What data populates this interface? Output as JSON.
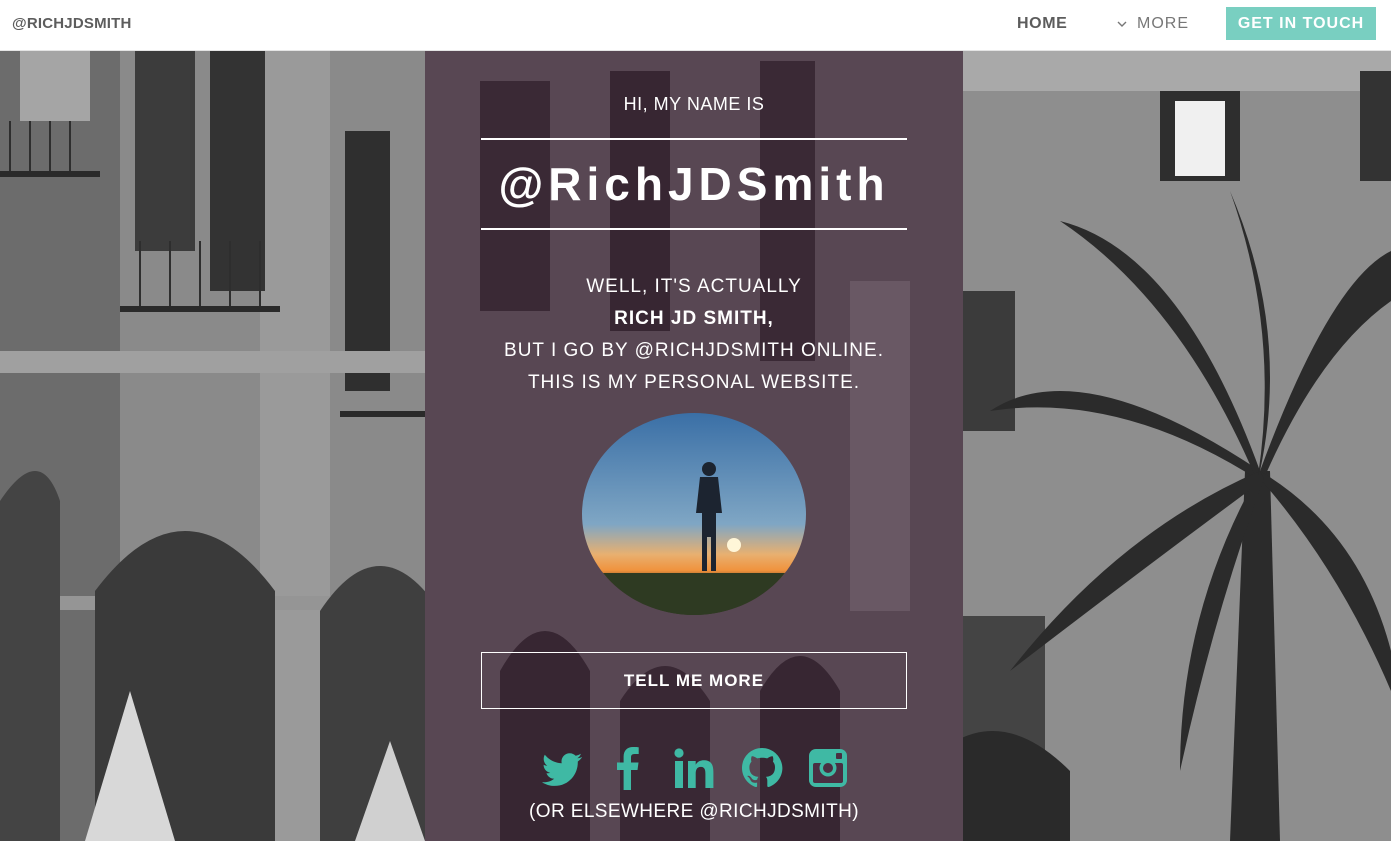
{
  "nav": {
    "brand": "@RICHJDSMITH",
    "home": "HOME",
    "more": "MORE",
    "cta": "GET IN TOUCH"
  },
  "hero": {
    "greeting": "HI, MY NAME IS",
    "handle": "@RichJDSmith",
    "intro_line1": "WELL, IT'S ACTUALLY",
    "intro_name": "RICH JD SMITH,",
    "intro_line3": "BUT I GO BY @RICHJDSMITH ONLINE.",
    "intro_line4": "THIS IS MY PERSONAL WEBSITE.",
    "button": "TELL ME MORE",
    "elsewhere": "(OR ELSEWHERE @RICHJDSMITH)"
  },
  "social": [
    {
      "icon": "twitter-icon"
    },
    {
      "icon": "facebook-icon"
    },
    {
      "icon": "linkedin-icon"
    },
    {
      "icon": "github-icon"
    },
    {
      "icon": "instagram-icon"
    }
  ],
  "colors": {
    "accent": "#79cfc1",
    "social": "#3fb9a4",
    "overlay": "#3a1e32",
    "nav_text": "#5c5c5c"
  }
}
